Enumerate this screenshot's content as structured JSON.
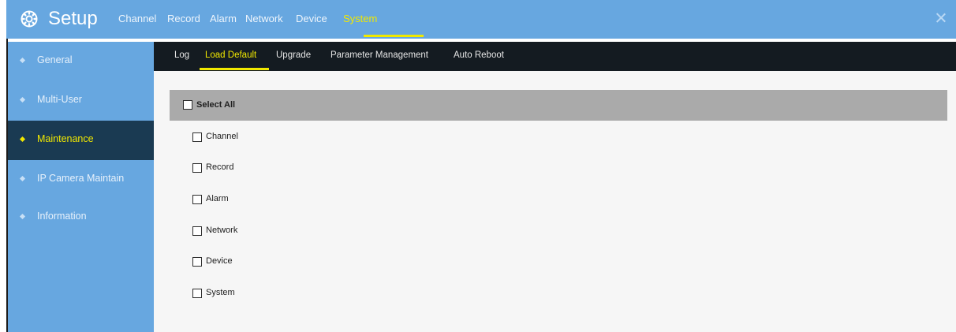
{
  "header": {
    "title": "Setup",
    "tabs": [
      {
        "label": "Channel",
        "active": false
      },
      {
        "label": "Record",
        "active": false
      },
      {
        "label": "Alarm",
        "active": false
      },
      {
        "label": "Network",
        "active": false
      },
      {
        "label": "Device",
        "active": false
      },
      {
        "label": "System",
        "active": true
      }
    ],
    "close_icon": "close-icon",
    "gear_icon": "gear-icon"
  },
  "sidebar": {
    "items": [
      {
        "label": "General",
        "active": false
      },
      {
        "label": "Multi-User",
        "active": false
      },
      {
        "label": "Maintenance",
        "active": true
      },
      {
        "label": "IP Camera Maintain",
        "active": false
      },
      {
        "label": "Information",
        "active": false
      }
    ]
  },
  "subtabs": [
    {
      "label": "Log",
      "active": false
    },
    {
      "label": "Load Default",
      "active": true
    },
    {
      "label": "Upgrade",
      "active": false
    },
    {
      "label": "Parameter Management",
      "active": false
    },
    {
      "label": "Auto Reboot",
      "active": false
    }
  ],
  "load_default": {
    "select_all_label": "Select All",
    "select_all_checked": false,
    "options": [
      {
        "label": "Channel",
        "checked": false
      },
      {
        "label": "Record",
        "checked": false
      },
      {
        "label": "Alarm",
        "checked": false
      },
      {
        "label": "Network",
        "checked": false
      },
      {
        "label": "Device",
        "checked": false
      },
      {
        "label": "System",
        "checked": false
      }
    ]
  },
  "colors": {
    "header_blue": "#67a7e0",
    "sidebar_active": "#1a3a52",
    "accent_yellow": "#f1e800",
    "subnav_dark": "#141b21",
    "selectall_gray": "#aaaaaa"
  }
}
